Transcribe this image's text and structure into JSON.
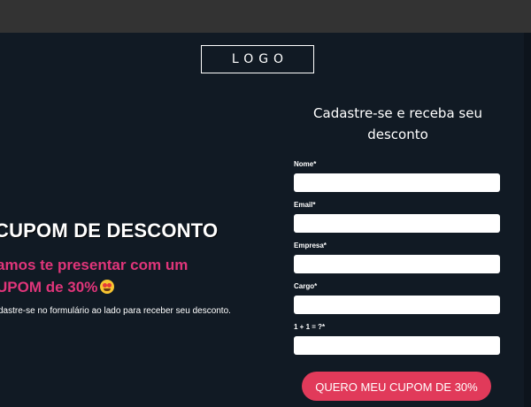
{
  "header": {
    "logo_text": "LOGO"
  },
  "hero": {
    "headline": "CUPOM DE DESCONTO",
    "subheadline_line1": "amos te presentar com um",
    "subheadline_line2": "UPOM de 30%",
    "emoji": "heart-eyes-emoji",
    "note": "dastre-se no formulário ao lado para receber seu desconto."
  },
  "form": {
    "title": "Cadastre-se e receba seu desconto",
    "fields": [
      {
        "label": "Nome*",
        "value": ""
      },
      {
        "label": "Email*",
        "value": ""
      },
      {
        "label": "Empresa*",
        "value": ""
      },
      {
        "label": "Cargo*",
        "value": ""
      },
      {
        "label": "1 + 1 = ?*",
        "value": ""
      }
    ],
    "submit_label": "QUERO MEU CUPOM DE 30%"
  },
  "colors": {
    "background": "#111a24",
    "topbar": "#333333",
    "accent_pink": "#e0357a",
    "button": "#e13a5a"
  }
}
